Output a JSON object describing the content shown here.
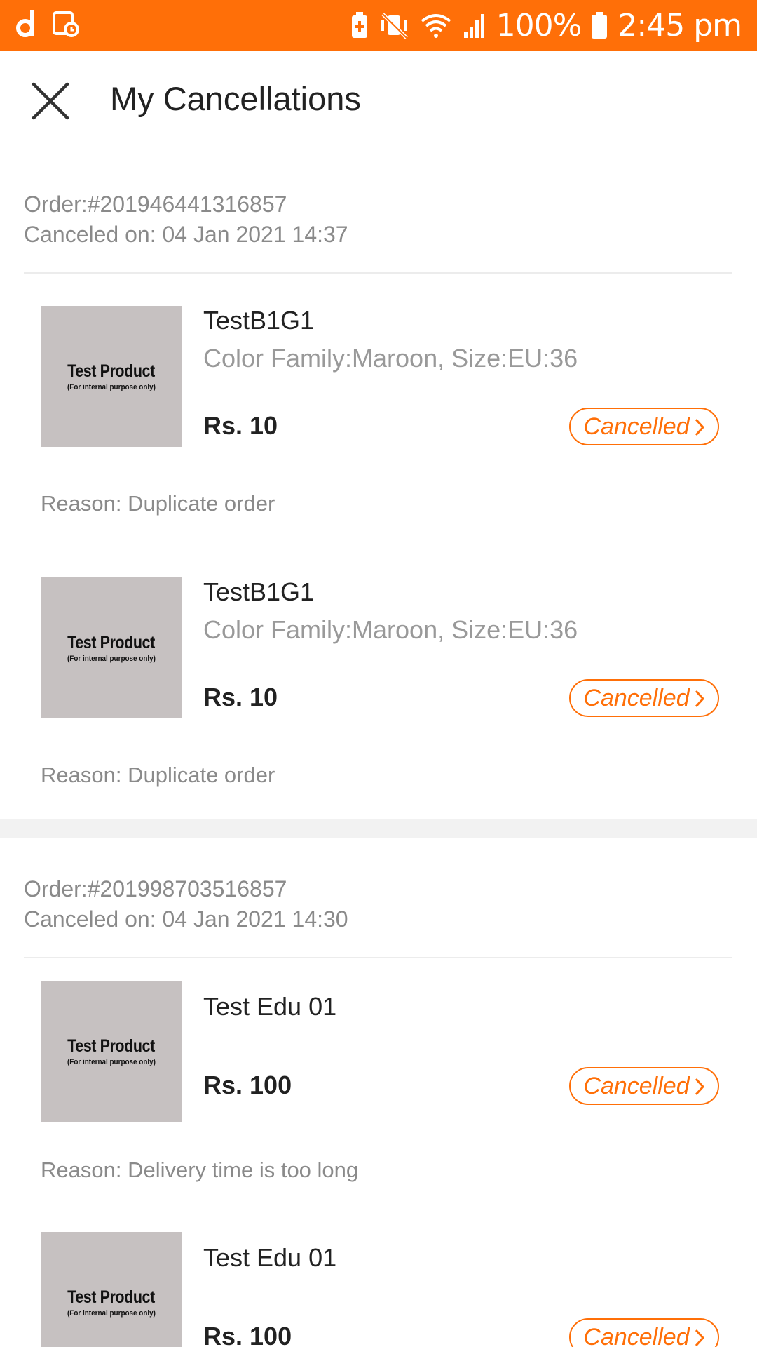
{
  "status_bar": {
    "battery_percent": "100%",
    "time": "2:45 pm",
    "accent_color": "#ff6f08",
    "icons": [
      "daraz-app-icon",
      "clock-calendar-icon",
      "battery-saver-icon",
      "vibrate-mute-icon",
      "wifi-icon",
      "signal-icon",
      "battery-icon"
    ]
  },
  "header": {
    "title": "My Cancellations",
    "close_icon": "close-icon"
  },
  "orders": [
    {
      "order_number": "Order:#201946441316857",
      "canceled_on": "Canceled on: 04 Jan 2021 14:37",
      "items": [
        {
          "thumb_title": "Test Product",
          "thumb_sub": "(For internal purpose only)",
          "name": "TestB1G1",
          "variant": "Color Family:Maroon, Size:EU:36",
          "price": "Rs. 10",
          "status": "Cancelled",
          "reason": "Reason: Duplicate order"
        },
        {
          "thumb_title": "Test Product",
          "thumb_sub": "(For internal purpose only)",
          "name": "TestB1G1",
          "variant": "Color Family:Maroon, Size:EU:36",
          "price": "Rs. 10",
          "status": "Cancelled",
          "reason": "Reason: Duplicate order"
        }
      ]
    },
    {
      "order_number": "Order:#201998703516857",
      "canceled_on": "Canceled on: 04 Jan 2021 14:30",
      "items": [
        {
          "thumb_title": "Test Product",
          "thumb_sub": "(For internal purpose only)",
          "name": "Test Edu 01",
          "price": "Rs. 100",
          "status": "Cancelled",
          "reason": "Reason: Delivery time is too long"
        },
        {
          "thumb_title": "Test Product",
          "thumb_sub": "(For internal purpose only)",
          "name": "Test Edu 01",
          "price": "Rs. 100",
          "status": "Cancelled"
        }
      ]
    }
  ]
}
